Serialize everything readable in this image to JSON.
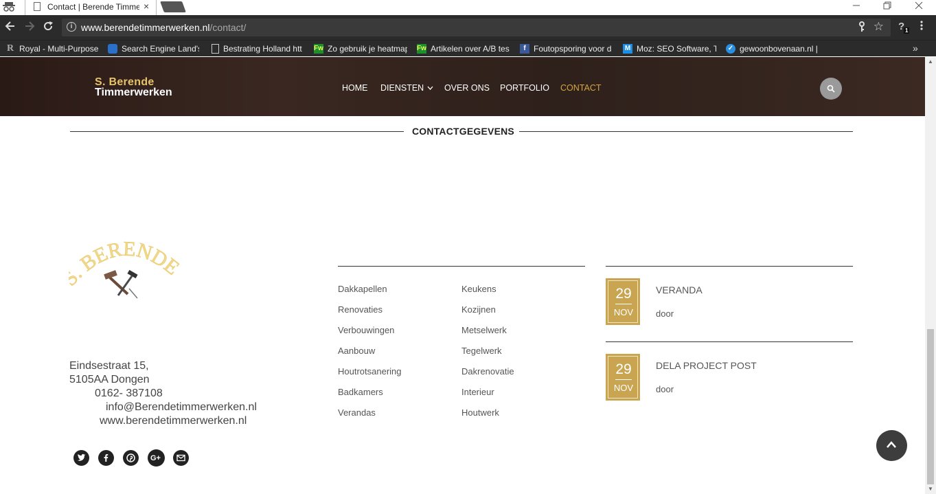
{
  "browser": {
    "tab_title": "Contact | Berende Timmerwerken",
    "tab_close": "×",
    "url_host": "www.berendetimmerwerken.nl",
    "url_path": "/contact/",
    "extension_badge": "1",
    "bookmarks": [
      {
        "label": "Royal - Multi-Purpose",
        "icon": "R"
      },
      {
        "label": "Search Engine Land's",
        "icon": "sel"
      },
      {
        "label": "Bestrating Holland htt",
        "icon": "doc"
      },
      {
        "label": "Zo gebruik je heatmap",
        "icon": "Fw"
      },
      {
        "label": "Artikelen over A/B tes",
        "icon": "Fw"
      },
      {
        "label": "Foutopsporing voor d",
        "icon": "f"
      },
      {
        "label": "Moz: SEO Software, To",
        "icon": "M"
      },
      {
        "label": "gewoonbovenaan.nl |",
        "icon": "check"
      }
    ],
    "bookmarks_more": "»"
  },
  "site": {
    "logo": {
      "line1": "S. Berende",
      "line2": "Timmerwerken"
    },
    "nav": [
      {
        "label": "HOME"
      },
      {
        "label": "DIENSTEN"
      },
      {
        "label": "OVER ONS"
      },
      {
        "label": "PORTFOLIO"
      },
      {
        "label": "CONTACT",
        "active": true
      }
    ],
    "section_title": "CONTACTGEGEVENS",
    "footer_logo_text": "S. BERENDE",
    "address": {
      "street": "Eindsestraat 15,",
      "city": "5105AA Dongen",
      "phone": "0162- 387108",
      "email": "info@Berendetimmerwerken.nl",
      "website": "www.berendetimmerwerken.nl"
    },
    "social": [
      "twitter-icon",
      "facebook-icon",
      "pinterest-icon",
      "google-plus-icon",
      "email-icon"
    ],
    "services_left": [
      "Dakkapellen",
      "Renovaties",
      "Verbouwingen",
      "Aanbouw",
      "Houtrotsanering",
      "Badkamers",
      "Verandas"
    ],
    "services_right": [
      "Keukens",
      "Kozijnen",
      "Metselwerk",
      "Tegelwerk",
      "Dakrenovatie",
      "Interieur",
      "Houtwerk"
    ],
    "posts": [
      {
        "day": "29",
        "month": "NOV",
        "title": "VERANDA",
        "by": "door"
      },
      {
        "day": "29",
        "month": "NOV",
        "title": "DELA PROJECT POST",
        "by": "door"
      }
    ],
    "colors": {
      "accent": "#c9a552",
      "nav_active": "#d6a640",
      "header_bg": "#2e201b"
    }
  }
}
